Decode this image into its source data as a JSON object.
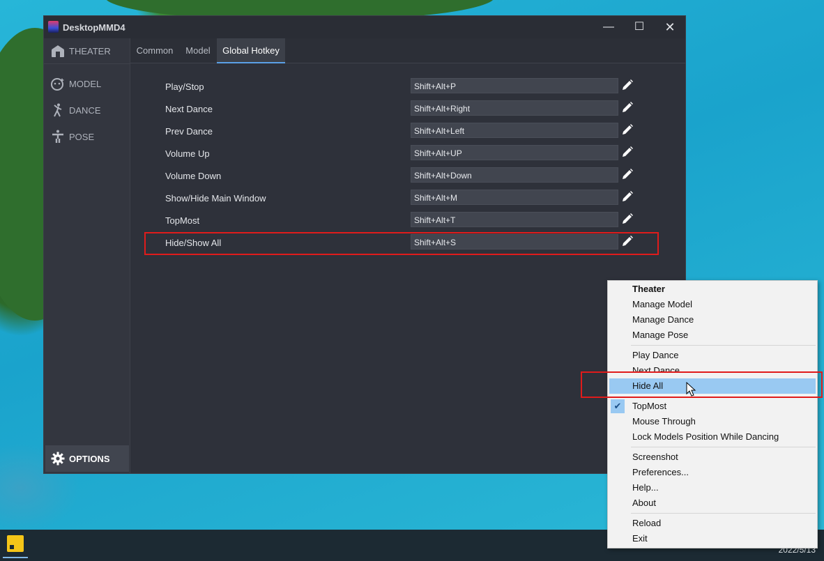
{
  "window": {
    "title": "DesktopMMD4",
    "minimize_glyph": "—",
    "maximize_glyph": "☐",
    "close_glyph": "✕"
  },
  "sidebar": {
    "items": [
      {
        "label": "THEATER",
        "icon": "theater-icon"
      },
      {
        "label": "MODEL",
        "icon": "model-icon"
      },
      {
        "label": "DANCE",
        "icon": "dance-icon"
      },
      {
        "label": "POSE",
        "icon": "pose-icon"
      }
    ],
    "options_label": "OPTIONS",
    "options_icon": "gear-icon"
  },
  "tabs": [
    {
      "label": "Common",
      "active": false
    },
    {
      "label": "Model",
      "active": false
    },
    {
      "label": "Global Hotkey",
      "active": true
    }
  ],
  "hotkeys": [
    {
      "label": "Play/Stop",
      "value": "Shift+Alt+P"
    },
    {
      "label": "Next Dance",
      "value": "Shift+Alt+Right"
    },
    {
      "label": "Prev Dance",
      "value": "Shift+Alt+Left"
    },
    {
      "label": "Volume Up",
      "value": "Shift+Alt+UP"
    },
    {
      "label": "Volume Down",
      "value": "Shift+Alt+Down"
    },
    {
      "label": "Show/Hide Main Window",
      "value": "Shift+Alt+M"
    },
    {
      "label": "TopMost",
      "value": "Shift+Alt+T"
    },
    {
      "label": "Hide/Show All",
      "value": "Shift+Alt+S"
    }
  ],
  "context_menu": {
    "items": [
      {
        "label": "Theater",
        "bold": true
      },
      {
        "label": "Manage Model"
      },
      {
        "label": "Manage Dance"
      },
      {
        "label": "Manage Pose"
      },
      {
        "label": "Play Dance"
      },
      {
        "label": "Next Dance"
      },
      {
        "label": "Hide All",
        "highlighted": true
      },
      {
        "label": "TopMost",
        "checked": true
      },
      {
        "label": "Mouse Through"
      },
      {
        "label": "Lock Models Position While Dancing"
      },
      {
        "label": "Screenshot"
      },
      {
        "label": "Preferences..."
      },
      {
        "label": "Help..."
      },
      {
        "label": "About"
      },
      {
        "label": "Reload"
      },
      {
        "label": "Exit"
      }
    ],
    "check_glyph": "✔"
  },
  "taskbar": {
    "date": "2022/5/13"
  },
  "colors": {
    "highlight_box": "#e01b1b",
    "menu_hover": "#99c9f2",
    "tab_accent": "#5aa0e6"
  }
}
